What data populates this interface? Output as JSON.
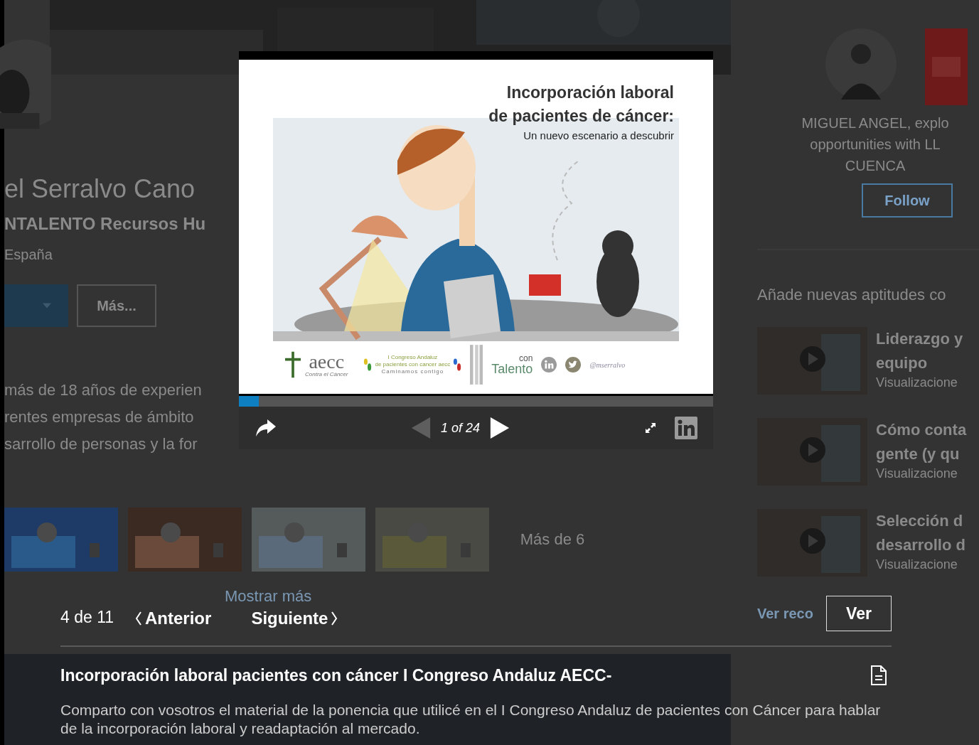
{
  "background": {
    "name": "el Serralvo Cano",
    "headline": "NTALENTO Recursos Hu",
    "location": "España",
    "more_button": "Más...",
    "about": [
      "más de 18 años de experien",
      "rentes empresas de ámbito",
      "sarrollo de personas y la for"
    ],
    "media": [
      {
        "kind": "picture"
      },
      {
        "kind": "picture"
      },
      {
        "kind": "picture"
      },
      {
        "kind": "picture"
      },
      {
        "kind": "more",
        "label": "Más de 6"
      }
    ],
    "show_more": "Mostrar más",
    "suggestion": {
      "lines": [
        "MIGUEL ANGEL, explo",
        "opportunities with LL",
        "CUENCA"
      ],
      "button": "Follow"
    },
    "courses_title": "Añade nuevas aptitudes co",
    "courses": [
      {
        "title": [
          "Liderazgo y",
          "equipo"
        ],
        "meta": "Visualizacione"
      },
      {
        "title": [
          "Cómo conta",
          "gente (y qu"
        ],
        "meta": "Visualizacione"
      },
      {
        "title": [
          "Selección d",
          "desarrollo d"
        ],
        "meta": "Visualizacione"
      }
    ],
    "recommendations_link": "Ver reco"
  },
  "slide": {
    "title": [
      "Incorporación laboral",
      "de pacientes de cáncer:"
    ],
    "subtitle": "Un nuevo escenario a descubrir",
    "logos": {
      "aecc": "aecc",
      "aecc_tag": "Contra el Cáncer",
      "congress": [
        "I Congreso Andaluz",
        "de pacientes con cancer aecc",
        "Caminamos contigo"
      ],
      "con": "con",
      "talento": "Talento",
      "handle": "@mserralvo"
    }
  },
  "player": {
    "progress": {
      "level": 0.042
    },
    "counter": "1 of 24",
    "prev": {
      "disabled": true
    },
    "next": {
      "disabled": false
    }
  },
  "viewer": {
    "position": "4 de 11",
    "prev_label": "Anterior",
    "next_label": "Siguiente",
    "open_button": "Ver",
    "title": "Incorporación laboral pacientes con cáncer I Congreso Andaluz AECC-",
    "description": "Comparto con vosotros el material de la ponencia que utilicé en el I Congreso Andaluz de pacientes con Cáncer para hablar de la incorporación laboral y readaptación al mercado."
  }
}
